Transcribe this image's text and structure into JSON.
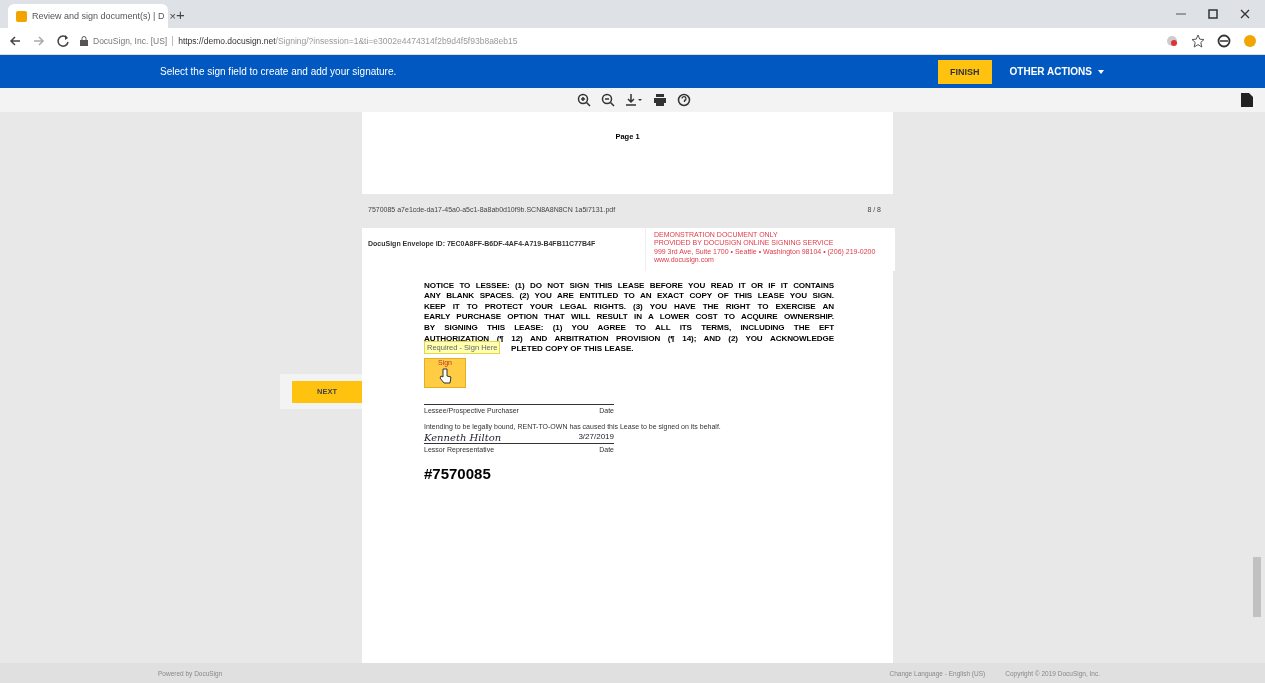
{
  "browser": {
    "tab": {
      "title": "Review and sign document(s) | D",
      "close": "×"
    },
    "new_tab": "+",
    "address": {
      "site": "DocuSign, Inc. [US]",
      "url_host": "https://demo.docusign.net",
      "url_path": "/Signing/?insession=1&ti=e3002e4474314f2b9d4f5f93b8a8eb15"
    }
  },
  "banner": {
    "message": "Select the sign field to create and add your signature.",
    "finish": "FINISH",
    "other_actions": "OTHER ACTIONS"
  },
  "document": {
    "page_label": "Page 1",
    "file_name": "7570085 a7e1cde-da17-45a0-a5c1-8a8ab0d10f9b.SCN8A8N8CN 1a5i7131.pdf",
    "page_count": "8 / 8",
    "envelope_id": "DocuSign Envelope ID: 7EC0A8FF-B6DF-4AF4-A719-B4FB11C77B4F",
    "demo_notice": [
      "DEMONSTRATION DOCUMENT ONLY",
      "PROVIDED BY DOCUSIGN ONLINE SIGNING SERVICE",
      "999 3rd Ave, Suite 1700  •  Seattle  •  Washington 98104  •  (206) 219-0200",
      "www.docusign.com"
    ],
    "notice_lines": [
      "NOTICE TO LESSEE: (1) DO NOT SIGN THIS LEASE BEFORE YOU READ IT OR IF IT CONTAINS",
      "ANY BLANK SPACES. (2) YOU ARE ENTITLED TO AN EXACT COPY OF THIS LEASE YOU SIGN.",
      "KEEP IT TO PROTECT YOUR LEGAL RIGHTS. (3) YOU HAVE THE RIGHT TO EXERCISE AN",
      "EARLY PURCHASE OPTION THAT WILL RESULT IN A LOWER COST TO ACQUIRE OWNERSHIP.",
      "BY SIGNING THIS LEASE: (1) YOU AGREE TO ALL ITS TERMS, INCLUDING THE EFT",
      "AUTHORIZATION (¶ 12) AND ARBITRATION PROVISION (¶ 14); AND (2) YOU ACKNOWLEDGE"
    ],
    "notice_tail": "PLETED COPY OF THIS LEASE.",
    "tooltip": "Required - Sign Here",
    "sign_field": "Sign",
    "lessee_label": "Lessee/Prospective Purchaser",
    "lessee_date_label": "Date",
    "lessor_statement": "Intending to be legally bound, RENT-TO-OWN has caused this Lease to be signed on its behalf.",
    "lessor_signature": "Kenneth Hilton",
    "lessor_date": "3/27/2019",
    "lessor_label": "Lessor Representative",
    "lessor_date_label": "Date",
    "contract_number": "#7570085"
  },
  "next": "NEXT",
  "footer": {
    "powered": "Powered by DocuSign",
    "language": "Change Language - English (US)",
    "copyright": "Copyright © 2019 DocuSign, Inc."
  }
}
